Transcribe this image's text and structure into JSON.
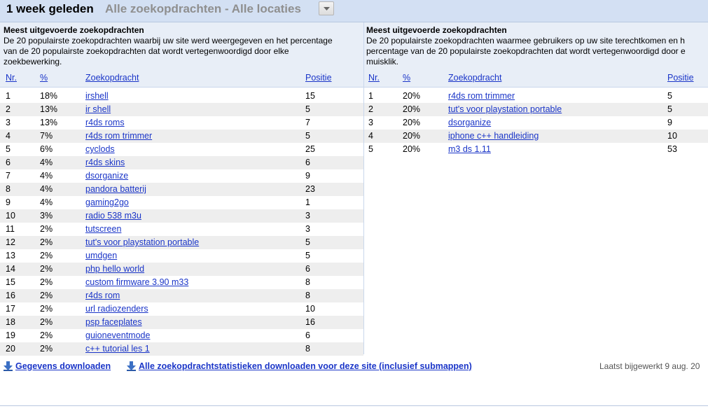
{
  "header": {
    "period": "1 week geleden",
    "filter": "Alle zoekopdrachten - Alle locaties"
  },
  "left_panel": {
    "title": "Meest uitgevoerde zoekopdrachten",
    "description_lines": [
      "De 20 populairste zoekopdrachten waarbij uw site werd weergegeven en het percentage",
      "van de 20 populairste zoekopdrachten dat wordt vertegenwoordigd door elke",
      "zoekbewerking."
    ],
    "columns": [
      "Nr.",
      "%",
      "Zoekopdracht",
      "Positie"
    ],
    "rows": [
      {
        "nr": "1",
        "pct": "18%",
        "query": "irshell",
        "pos": "15"
      },
      {
        "nr": "2",
        "pct": "13%",
        "query": "ir shell",
        "pos": "5"
      },
      {
        "nr": "3",
        "pct": "13%",
        "query": "r4ds roms",
        "pos": "7"
      },
      {
        "nr": "4",
        "pct": "7%",
        "query": "r4ds rom trimmer",
        "pos": "5"
      },
      {
        "nr": "5",
        "pct": "6%",
        "query": "cyclods",
        "pos": "25"
      },
      {
        "nr": "6",
        "pct": "4%",
        "query": "r4ds skins",
        "pos": "6"
      },
      {
        "nr": "7",
        "pct": "4%",
        "query": "dsorganize",
        "pos": "9"
      },
      {
        "nr": "8",
        "pct": "4%",
        "query": "pandora batterij",
        "pos": "23"
      },
      {
        "nr": "9",
        "pct": "4%",
        "query": "gaming2go",
        "pos": "1"
      },
      {
        "nr": "10",
        "pct": "3%",
        "query": "radio 538 m3u",
        "pos": "3"
      },
      {
        "nr": "11",
        "pct": "2%",
        "query": "tutscreen",
        "pos": "3"
      },
      {
        "nr": "12",
        "pct": "2%",
        "query": "tut's voor playstation portable",
        "pos": "5"
      },
      {
        "nr": "13",
        "pct": "2%",
        "query": "umdgen",
        "pos": "5"
      },
      {
        "nr": "14",
        "pct": "2%",
        "query": "php hello world",
        "pos": "6"
      },
      {
        "nr": "15",
        "pct": "2%",
        "query": "custom firmware 3.90 m33",
        "pos": "8"
      },
      {
        "nr": "16",
        "pct": "2%",
        "query": "r4ds rom",
        "pos": "8"
      },
      {
        "nr": "17",
        "pct": "2%",
        "query": "url radiozenders",
        "pos": "10"
      },
      {
        "nr": "18",
        "pct": "2%",
        "query": "psp faceplates",
        "pos": "16"
      },
      {
        "nr": "19",
        "pct": "2%",
        "query": "guioneventmode",
        "pos": "6"
      },
      {
        "nr": "20",
        "pct": "2%",
        "query": "c++ tutorial les 1",
        "pos": "8"
      }
    ]
  },
  "right_panel": {
    "title": "Meest uitgevoerde zoekopdrachten",
    "description_lines": [
      "De 20 populairste zoekopdrachten waarmee gebruikers op uw site terechtkomen en h",
      "percentage van de 20 populairste zoekopdrachten dat wordt vertegenwoordigd door e",
      "muisklik."
    ],
    "columns": [
      "Nr.",
      "%",
      "Zoekopdracht",
      "Positie"
    ],
    "rows": [
      {
        "nr": "1",
        "pct": "20%",
        "query": "r4ds rom trimmer",
        "pos": "5"
      },
      {
        "nr": "2",
        "pct": "20%",
        "query": "tut's voor playstation portable",
        "pos": "5"
      },
      {
        "nr": "3",
        "pct": "20%",
        "query": "dsorganize",
        "pos": "9"
      },
      {
        "nr": "4",
        "pct": "20%",
        "query": "iphone c++ handleiding",
        "pos": "10"
      },
      {
        "nr": "5",
        "pct": "20%",
        "query": "m3 ds 1.11",
        "pos": "53"
      }
    ]
  },
  "footer": {
    "download_label": "Gegevens downloaden",
    "download_all_label": "Alle zoekopdrachtstatistieken downloaden voor deze site (inclusief submappen)",
    "updated": "Laatst bijgewerkt 9 aug. 20"
  },
  "icons": {
    "dropdown": "chevron-down-icon",
    "download": "download-arrow-icon"
  },
  "colors": {
    "link": "#1a35c8",
    "header_bg": "#d3e0f3",
    "panel_head_bg": "#e8eef7",
    "row_alt": "#eeeeee"
  }
}
